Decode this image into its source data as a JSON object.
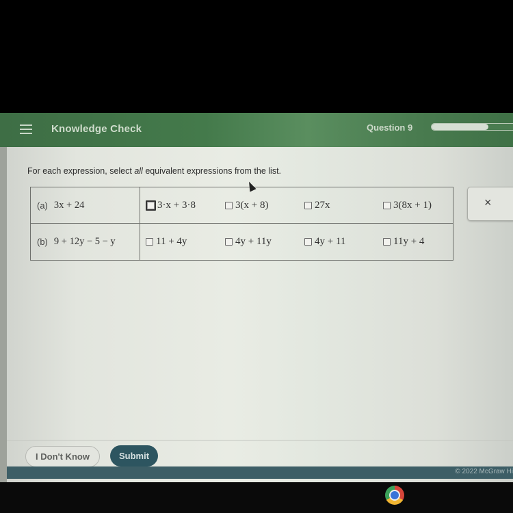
{
  "header": {
    "menu_icon": "hamburger-menu-icon",
    "title": "Knowledge Check",
    "question_label": "Question 9",
    "progress_fraction": 0.6
  },
  "instructions": {
    "before": "For each expression, select ",
    "emphasis": "all",
    "after": " equivalent expressions from the list."
  },
  "questions": [
    {
      "part": "(a)",
      "expression": "3x + 24",
      "options": [
        {
          "label": "3·x + 3·8",
          "checked": false,
          "focused": true
        },
        {
          "label": "3(x + 8)",
          "checked": false,
          "focused": false
        },
        {
          "label": "27x",
          "checked": false,
          "focused": false
        },
        {
          "label": "3(8x + 1)",
          "checked": false,
          "focused": false
        }
      ]
    },
    {
      "part": "(b)",
      "expression": "9 + 12y − 5 − y",
      "options": [
        {
          "label": "11 + 4y",
          "checked": false,
          "focused": false
        },
        {
          "label": "4y + 11y",
          "checked": false,
          "focused": false
        },
        {
          "label": "4y + 11",
          "checked": false,
          "focused": false
        },
        {
          "label": "11y + 4",
          "checked": false,
          "focused": false
        }
      ]
    }
  ],
  "close_button": {
    "symbol": "×",
    "icon": "close-icon"
  },
  "footer": {
    "dont_know_label": "I Don't Know",
    "submit_label": "Submit",
    "copyright": "© 2022 McGraw Hi"
  },
  "taskbar": {
    "pinned_icon": "chrome-icon"
  },
  "colors": {
    "header_green": "#447a4b",
    "submit_teal": "#2d5560",
    "footer_bar": "#3d5e66"
  }
}
